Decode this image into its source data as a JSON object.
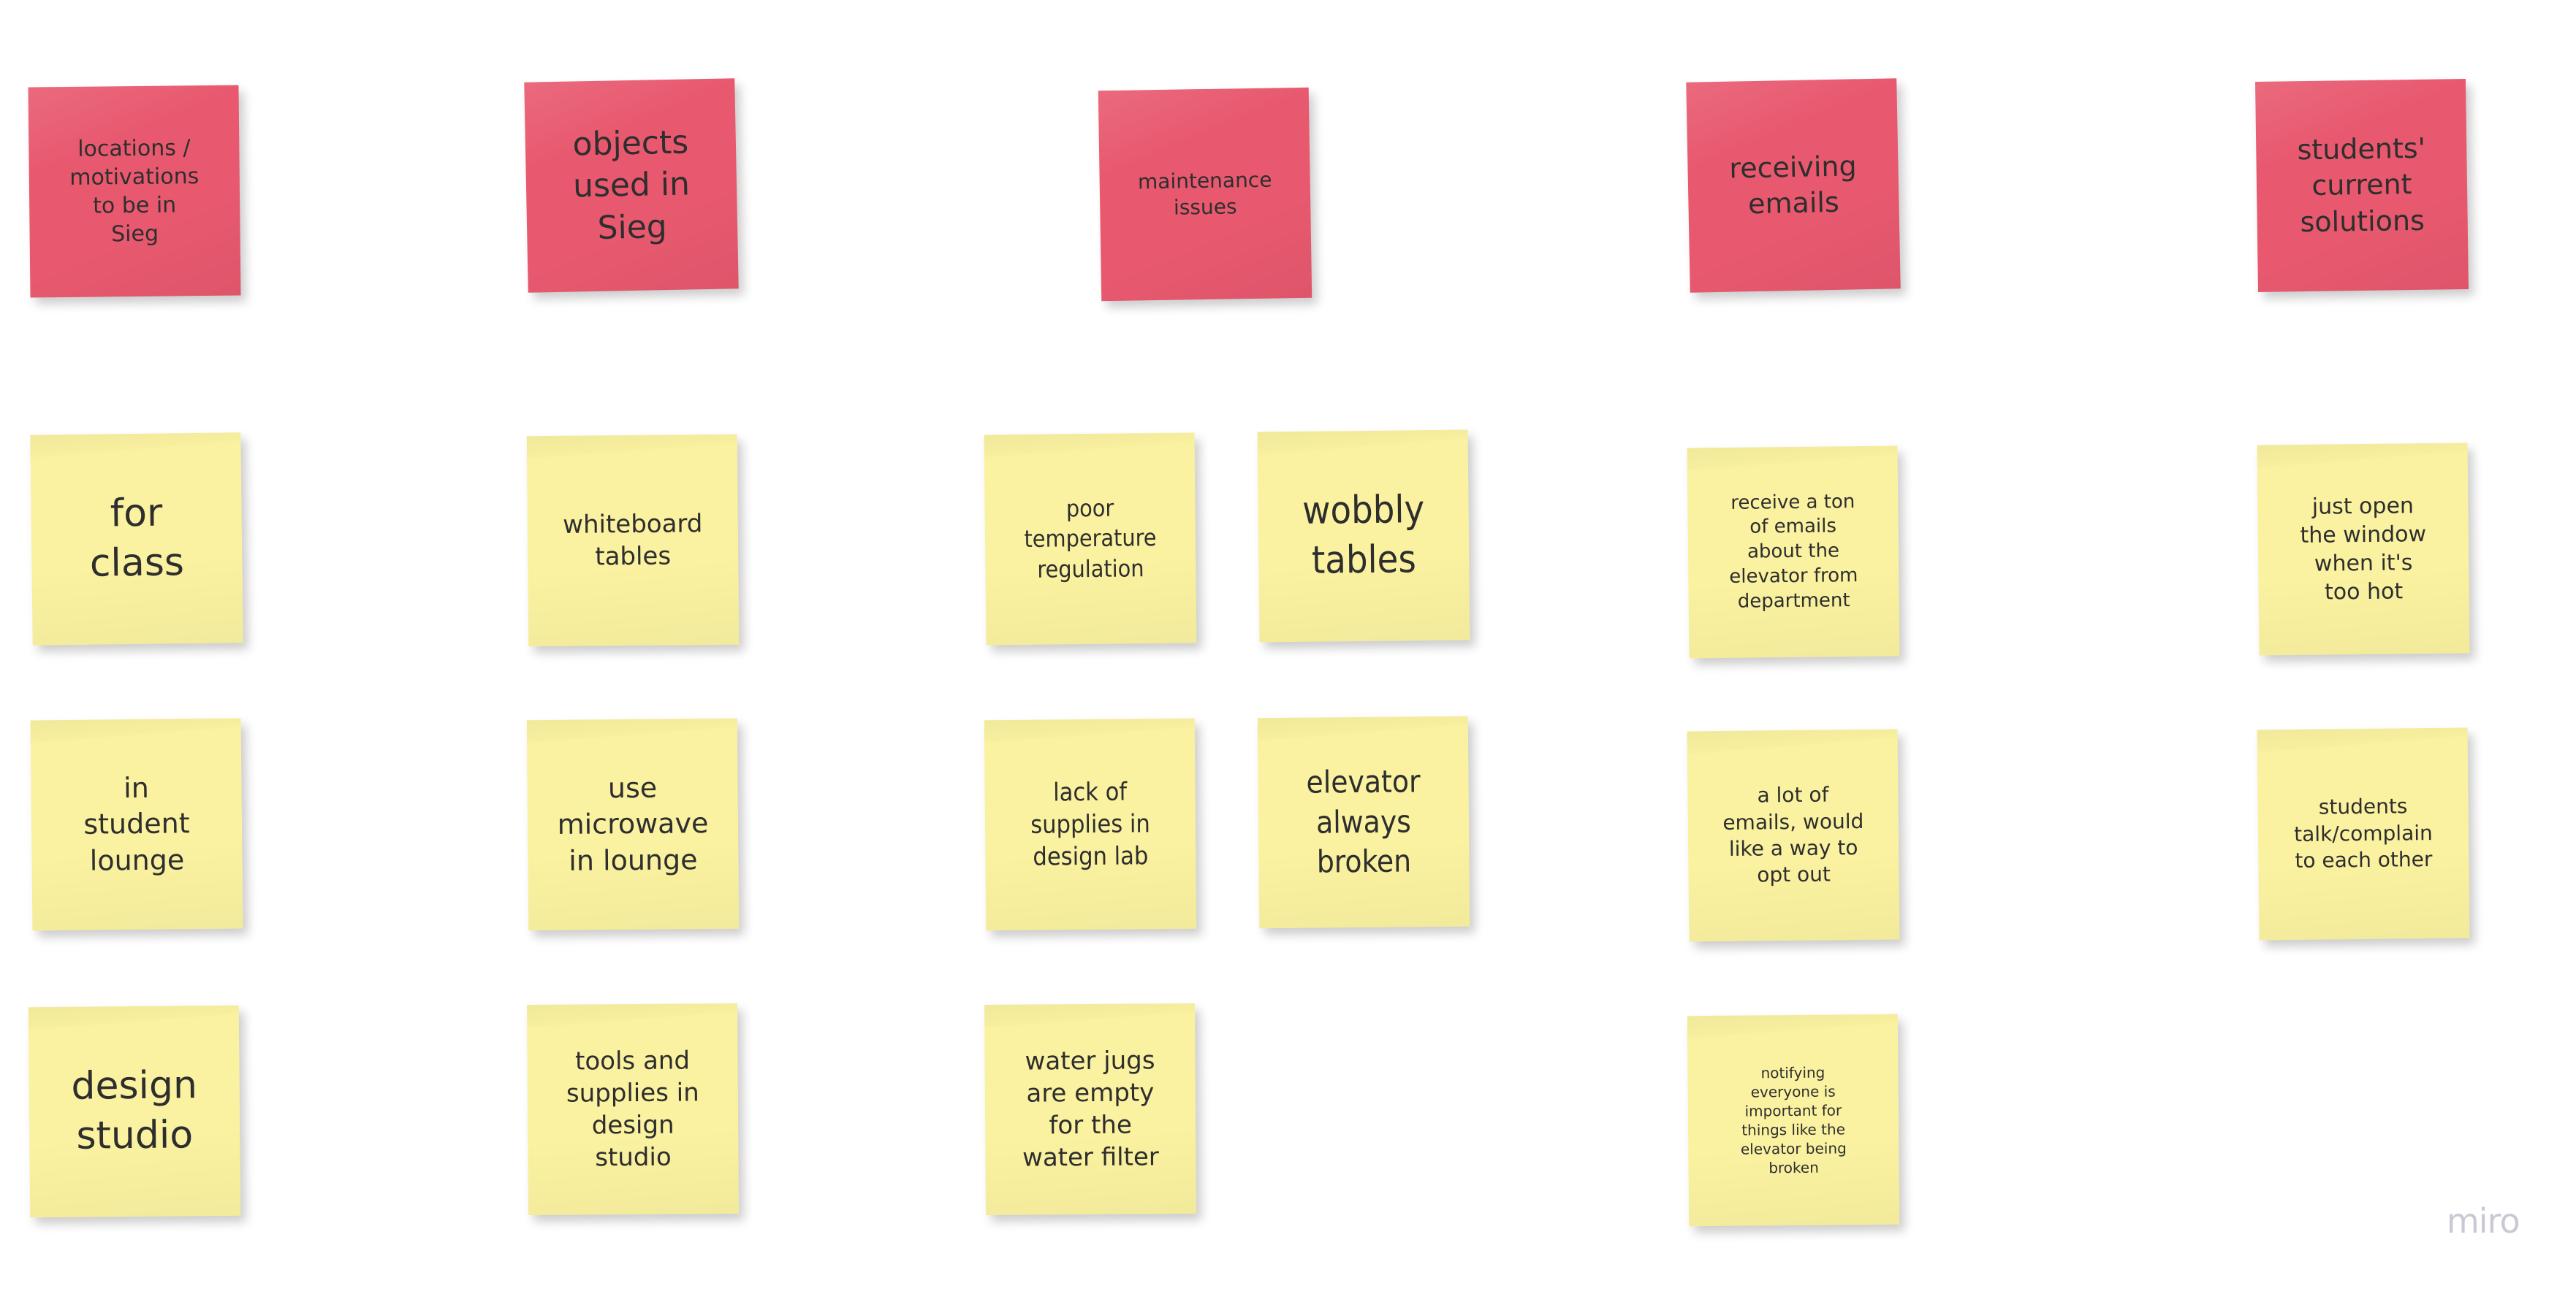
{
  "board": {
    "background_color": "#ffffff",
    "watermark": "miro",
    "watermark_color": "#c9c9d6",
    "note_colors": {
      "header": "#e8596f",
      "body": "#faf2a0"
    },
    "text_color": "#2e2e2e"
  },
  "columns": [
    {
      "id": "locations-motivations",
      "header": "locations /\nmotivations\nto be in\nSieg",
      "notes": [
        "for\nclass",
        "in\nstudent\nlounge",
        "design\nstudio"
      ]
    },
    {
      "id": "objects-used",
      "header": "objects\nused in\nSieg",
      "notes": [
        "whiteboard\ntables",
        "use\nmicrowave\nin lounge",
        "tools and\nsupplies in\ndesign\nstudio"
      ]
    },
    {
      "id": "maintenance-issues",
      "header": "maintenance\nissues",
      "notes": [
        "poor\ntemperature\nregulation",
        "wobbly\ntables",
        "lack of\nsupplies in\ndesign lab",
        "elevator\nalways\nbroken",
        "water jugs\nare empty\nfor the\nwater filter"
      ]
    },
    {
      "id": "receiving-emails",
      "header": "receiving\nemails",
      "notes": [
        "receive a ton\nof emails\nabout the\nelevator from\ndepartment",
        "a lot of\nemails, would\nlike a way to\nopt out",
        "notifying\neveryone is\nimportant for\nthings like the\nelevator being\nbroken"
      ]
    },
    {
      "id": "students-current-solutions",
      "header": "students'\ncurrent\nsolutions",
      "notes": [
        "just open\nthe window\nwhen it's\ntoo hot",
        "students\ntalk/complain\nto each other"
      ]
    }
  ]
}
